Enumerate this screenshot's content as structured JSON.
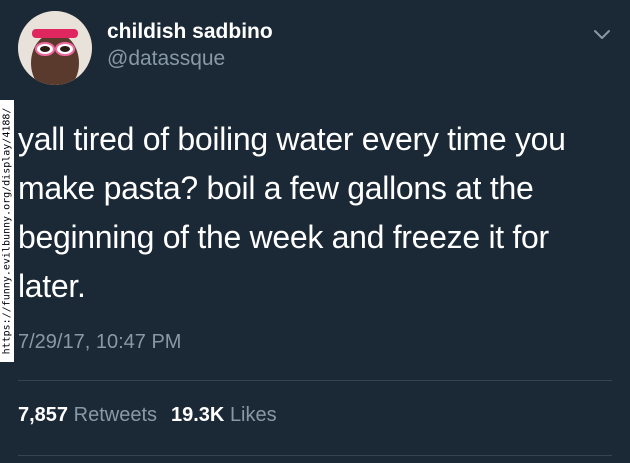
{
  "user": {
    "display_name": "childish sadbino",
    "handle": "@datassque"
  },
  "tweet": {
    "text": "yall tired of boiling water every time you make pasta? boil a few gallons at the beginning of the week and freeze it for later.",
    "timestamp": "7/29/17, 10:47 PM"
  },
  "stats": {
    "retweets_count": "7,857",
    "retweets_label": "Retweets",
    "likes_count": "19.3K",
    "likes_label": "Likes"
  },
  "watermark": {
    "text": "https://funny.evilbunny.org/display/4188/"
  },
  "icons": {
    "menu": "chevron-down-icon",
    "avatar": "avatar"
  },
  "colors": {
    "background": "#1b2836",
    "primary_text": "#ffffff",
    "secondary_text": "#8899a6",
    "divider": "#38444d"
  }
}
